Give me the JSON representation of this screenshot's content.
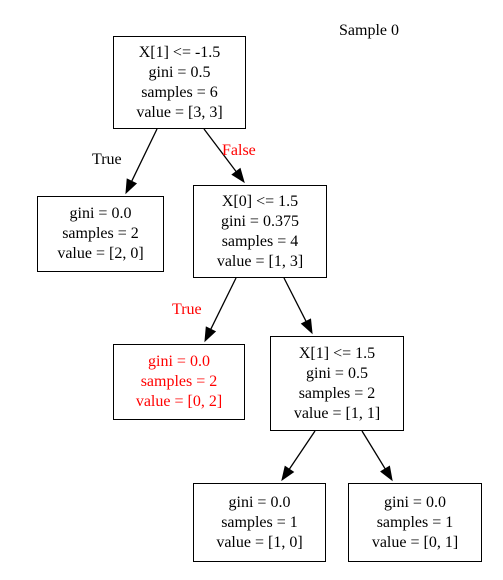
{
  "title": "Sample 0",
  "colors": {
    "stroke": "#000000",
    "highlight": "#ff0000",
    "background": "#ffffff"
  },
  "nodes": [
    {
      "lines": [
        "X[1] <= -1.5",
        "gini = 0.5",
        "samples = 6",
        "value = [3, 3]"
      ],
      "highlight": false
    },
    {
      "lines": [
        "gini = 0.0",
        "samples = 2",
        "value = [2, 0]"
      ],
      "highlight": false
    },
    {
      "lines": [
        "X[0] <= 1.5",
        "gini = 0.375",
        "samples = 4",
        "value = [1, 3]"
      ],
      "highlight": false
    },
    {
      "lines": [
        "gini = 0.0",
        "samples = 2",
        "value = [0, 2]"
      ],
      "highlight": true
    },
    {
      "lines": [
        "X[1] <= 1.5",
        "gini = 0.5",
        "samples = 2",
        "value = [1, 1]"
      ],
      "highlight": false
    },
    {
      "lines": [
        "gini = 0.0",
        "samples = 1",
        "value = [1, 0]"
      ],
      "highlight": false
    },
    {
      "lines": [
        "gini = 0.0",
        "samples = 1",
        "value = [0, 1]"
      ],
      "highlight": false
    }
  ],
  "edge_labels": [
    {
      "text": "True",
      "highlight": false
    },
    {
      "text": "False",
      "highlight": true
    },
    {
      "text": "True",
      "highlight": true
    }
  ]
}
